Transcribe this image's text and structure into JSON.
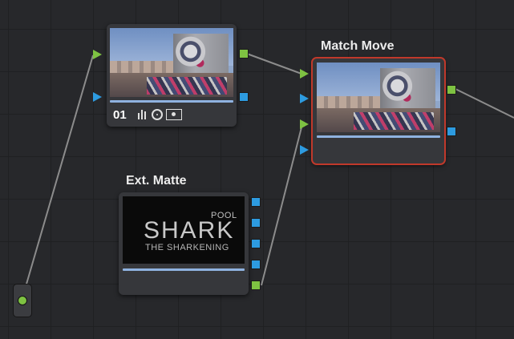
{
  "nodes": {
    "node01": {
      "number": "01",
      "icons": [
        "levels-icon",
        "circle-target-icon",
        "camera-icon"
      ]
    },
    "match_move": {
      "title": "Match Move",
      "selected": true
    },
    "ext_matte": {
      "title": "Ext. Matte",
      "thumbnail_text": {
        "top": "POOL",
        "main": "SHARK",
        "sub": "THE SHARKENING"
      }
    }
  },
  "colors": {
    "port_green": "#7ec242",
    "port_blue": "#2d9be0",
    "selection": "#c0392b",
    "wire": "#8c8c8c"
  }
}
